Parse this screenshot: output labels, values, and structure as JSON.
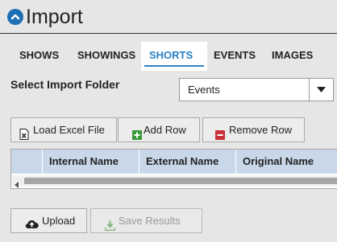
{
  "header": {
    "title": "Import",
    "icon": "chevron-up-circle-icon",
    "icon_color": "#1e6fb3"
  },
  "tabs": [
    {
      "label": "SHOWS",
      "active": false
    },
    {
      "label": "SHOWINGS",
      "active": false
    },
    {
      "label": "SHORTS",
      "active": true
    },
    {
      "label": "EVENTS",
      "active": false
    },
    {
      "label": "IMAGES",
      "active": false
    }
  ],
  "accent_color": "#2b82c6",
  "import_folder": {
    "label": "Select Import Folder",
    "selected": "Events"
  },
  "toolbar": {
    "load_excel_label": "Load Excel File",
    "add_row_label": "Add Row",
    "remove_row_label": "Remove Row"
  },
  "grid": {
    "columns": [
      "Internal Name",
      "External Name",
      "Original Name"
    ],
    "rows": []
  },
  "actions": {
    "upload_label": "Upload",
    "save_results_label": "Save Results",
    "save_results_enabled": false
  }
}
